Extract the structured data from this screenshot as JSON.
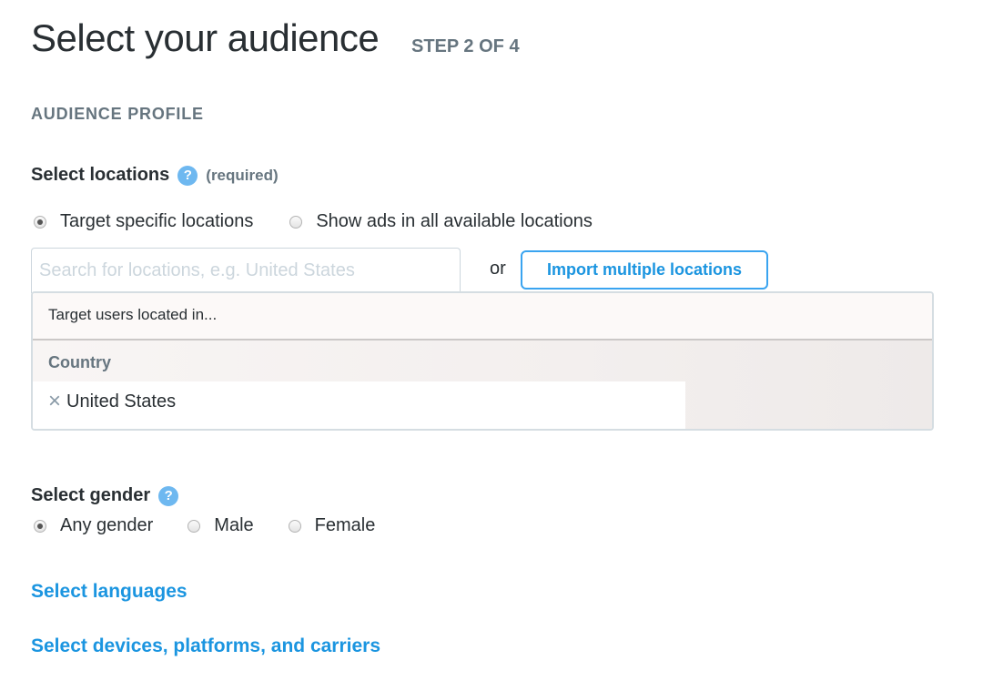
{
  "header": {
    "title": "Select your audience",
    "step": "STEP 2 OF 4"
  },
  "section": {
    "label": "AUDIENCE PROFILE"
  },
  "locations": {
    "label": "Select locations",
    "help_icon": "?",
    "required": "(required)",
    "options": [
      {
        "label": "Target specific locations",
        "checked": true
      },
      {
        "label": "Show ads in all available locations",
        "checked": false
      }
    ],
    "search_placeholder": "Search for locations, e.g. United States",
    "search_value": "",
    "or_text": "or",
    "import_button": "Import multiple locations",
    "panel": {
      "header": "Target users located in...",
      "group_heading": "Country",
      "items": [
        {
          "name": "United States",
          "remove_icon": "×"
        }
      ]
    }
  },
  "gender": {
    "label": "Select gender",
    "help_icon": "?",
    "options": [
      {
        "label": "Any gender",
        "checked": true
      },
      {
        "label": "Male",
        "checked": false
      },
      {
        "label": "Female",
        "checked": false
      }
    ]
  },
  "links": {
    "languages": "Select languages",
    "devices": "Select devices, platforms, and carriers"
  },
  "colors": {
    "accent": "#1b95e0",
    "help": "#55acee",
    "muted": "#66757f",
    "text": "#292f33"
  }
}
